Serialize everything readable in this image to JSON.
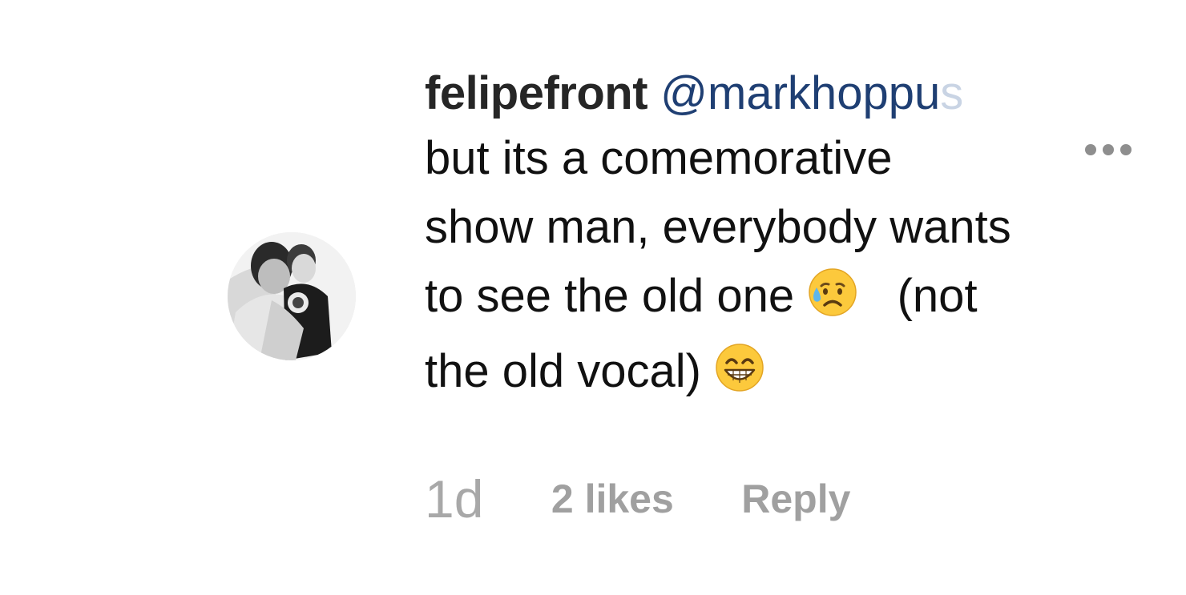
{
  "comment": {
    "username": "felipefront",
    "mention_visible": "@markhoppu",
    "mention_faded": "s",
    "text_lines": [
      "but its a comemorative",
      "show man, everybody wants",
      "to see the old one",
      "(not",
      "the old vocal)"
    ],
    "emojis": {
      "sad_sweat": "sad-but-relieved-face-icon",
      "grin": "grinning-face-icon"
    },
    "age": "1d",
    "likes_label": "2 likes",
    "reply_label": "Reply",
    "more_icon": "more-options-icon"
  }
}
